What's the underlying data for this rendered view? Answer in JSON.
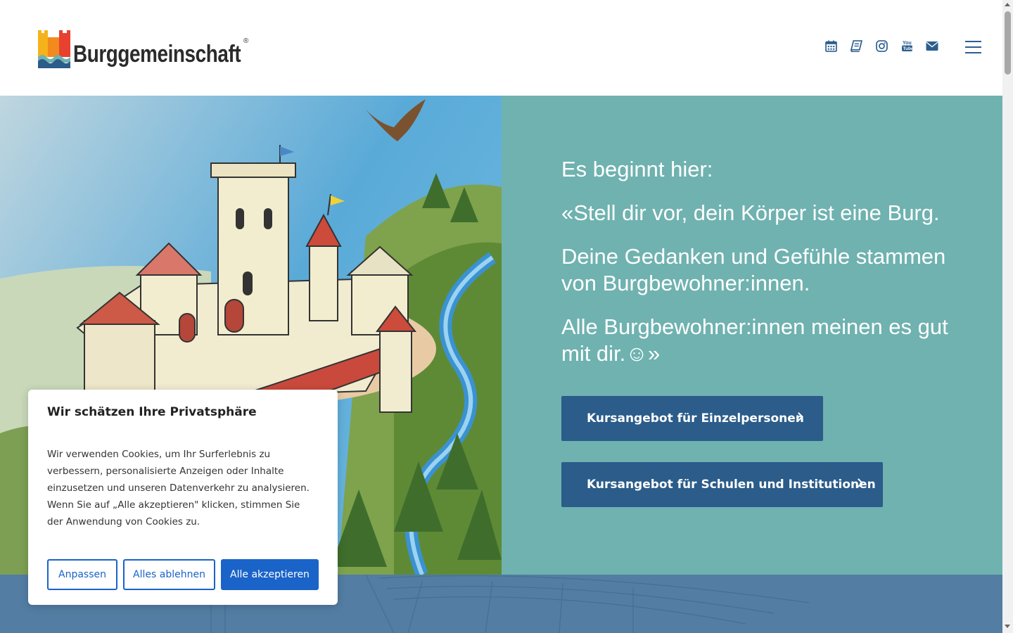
{
  "header": {
    "logo_text": "Burggemeinschaft",
    "logo_reg": "®",
    "icons": [
      "calendar-icon",
      "book-icon",
      "instagram-icon",
      "youtube-icon",
      "envelope-icon"
    ],
    "menu": "hamburger-menu-icon"
  },
  "hero": {
    "lines": [
      "Es beginnt hier:",
      "«Stell dir vor, dein Körper ist eine Burg.",
      "Deine Gedanken und Gefühle stammen von Burgbewohner:innen.",
      "Alle Burgbewohner:innen meinen es gut mit dir.☺»"
    ],
    "cta_individuals": "Kursangebot für Einzelpersonen",
    "cta_schools": "Kursangebot für Schulen und Institutionen"
  },
  "cookie": {
    "title": "Wir schätzen Ihre Privatsphäre",
    "body": "Wir verwenden Cookies, um Ihr Surferlebnis zu verbessern, personalisierte Anzeigen oder Inhalte einzusetzen und unseren Datenverkehr zu analysieren. Wenn Sie auf „Alle akzeptieren\" klicken, stimmen Sie der Anwendung von Cookies zu.",
    "btn_customize": "Anpassen",
    "btn_reject": "Alles ablehnen",
    "btn_accept": "Alle akzeptieren"
  },
  "colors": {
    "panel": "#6fb2b0",
    "button": "#2b5c8a",
    "accent": "#1a63c9",
    "band": "#537da3"
  }
}
